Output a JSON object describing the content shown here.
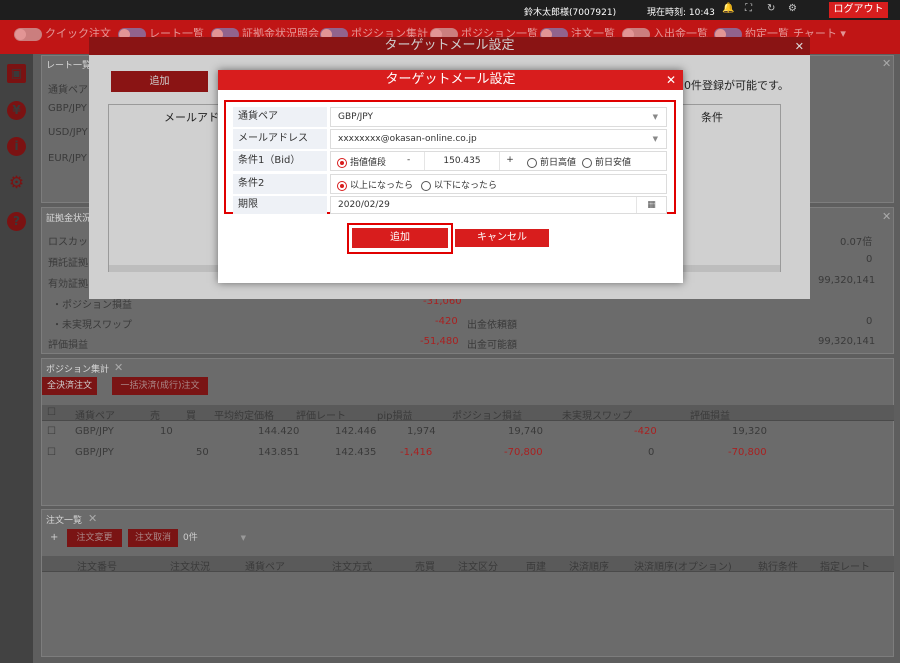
{
  "header": {
    "user": "鈴木太郎様(7007921)",
    "time_label": "現在時刻: 10:43",
    "logout": "ログアウト",
    "icons": [
      "bell-icon",
      "fullscreen-icon",
      "refresh-icon",
      "gear-icon"
    ]
  },
  "toolbar": {
    "items": [
      "クイック注文",
      "レート一覧",
      "証拠金状況照会",
      "ポジション集計",
      "ポジション一覧",
      "注文一覧",
      "入出金一覧",
      "約定一覧"
    ],
    "chart": "チャート"
  },
  "sidebar": {
    "icons": [
      "save-icon",
      "yen-icon",
      "info-icon",
      "gear-icon",
      "help-icon"
    ]
  },
  "rate_panel": {
    "title": "レート一覧",
    "rows": [
      "通貨ペア",
      "GBP/JPY",
      "USD/JPY",
      "EUR/JPY"
    ]
  },
  "margin_panel": {
    "title": "証拠金状況",
    "labels": [
      "ロスカット",
      "預託証拠",
      "有効証拠",
      "・ポジション損益",
      "・未実現スワップ",
      "評価損益"
    ],
    "values": [
      "",
      "",
      "",
      "-31,060",
      "-420",
      "-51,480"
    ],
    "right_labels": [
      "",
      "",
      "",
      "",
      "出金依頼額",
      "出金可能額"
    ],
    "right_values": [
      "0.07倍",
      "0",
      "99,320,141",
      "",
      "0",
      "99,320,141"
    ]
  },
  "position_panel": {
    "title": "ポジション集計",
    "btn_close_all": "全決済注文",
    "btn_bulk": "一括決済(成行)注文",
    "columns": [
      "通貨ペア",
      "売",
      "買",
      "平均約定価格",
      "評価レート",
      "pip損益",
      "ポジション損益",
      "未実現スワップ",
      "評価損益"
    ],
    "rows": [
      [
        "GBP/JPY",
        "10",
        "",
        "144.420",
        "142.446",
        "1,974",
        "19,740",
        "-420",
        "19,320"
      ],
      [
        "GBP/JPY",
        "",
        "50",
        "143.851",
        "142.435",
        "-1,416",
        "-70,800",
        "0",
        "-70,800"
      ]
    ]
  },
  "order_panel": {
    "title": "注文一覧",
    "btn_change": "注文変更",
    "btn_cancel": "注文取消",
    "count": "0件",
    "columns": [
      "注文番号",
      "注文状況",
      "通貨ペア",
      "注文方式",
      "売買",
      "注文区分",
      "両建",
      "決済順序",
      "決済順序(オプション)",
      "執行条件",
      "指定レート"
    ]
  },
  "mail_dialog_back": {
    "title": "ターゲットメール設定",
    "add": "追加",
    "note": "0件登録が可能です。",
    "col_mail": "メールアドレス",
    "col_cond": "条件"
  },
  "mail_dialog": {
    "title": "ターゲットメール設定",
    "pair_label": "通貨ペア",
    "pair_value": "GBP/JPY",
    "mail_label": "メールアドレス",
    "mail_value": "xxxxxxxx@okasan-online.co.jp",
    "cond1_label": "条件1（Bid）",
    "cond1_opt1": "指値値段",
    "minus": "-",
    "price": "150.435",
    "plus": "+",
    "cond1_opt2": "前日高値",
    "cond1_opt3": "前日安値",
    "cond2_label": "条件2",
    "cond2_opt1": "以上になったら",
    "cond2_opt2": "以下になったら",
    "limit_label": "期限",
    "limit_value": "2020/02/29",
    "add": "追加",
    "cancel": "キャンセル"
  }
}
